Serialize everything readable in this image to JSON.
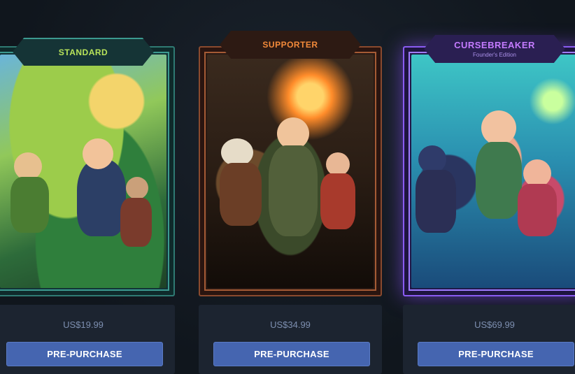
{
  "editions": [
    {
      "id": "standard",
      "title": "STANDARD",
      "subtitle": "",
      "price": "US$19.99",
      "button_label": "PRE-PURCHASE",
      "accent_color": "#b8e35a"
    },
    {
      "id": "supporter",
      "title": "SUPPORTER",
      "subtitle": "",
      "price": "US$34.99",
      "button_label": "PRE-PURCHASE",
      "accent_color": "#f38a3a"
    },
    {
      "id": "cursebreaker",
      "title": "CURSEBREAKER",
      "subtitle": "Founder's Edition",
      "price": "US$69.99",
      "button_label": "PRE-PURCHASE",
      "accent_color": "#c47bff"
    }
  ],
  "colors": {
    "background": "#121820",
    "button": "#4565b0",
    "price_text": "#7d8fb0"
  }
}
